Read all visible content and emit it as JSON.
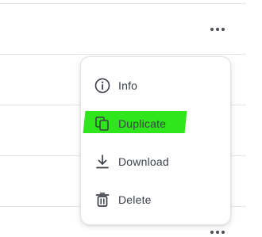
{
  "list": {
    "more_button_icon": "more-horizontal-icon"
  },
  "context_menu": {
    "items": [
      {
        "label": "Info",
        "icon": "info-circle-icon"
      },
      {
        "label": "Duplicate",
        "icon": "duplicate-icon",
        "highlight_color": "#2ee61b"
      },
      {
        "label": "Download",
        "icon": "download-icon"
      },
      {
        "label": "Delete",
        "icon": "trash-icon"
      }
    ]
  },
  "colors": {
    "text": "#3c4148",
    "divider": "#e6e6e6",
    "highlight": "#2ee61b"
  }
}
